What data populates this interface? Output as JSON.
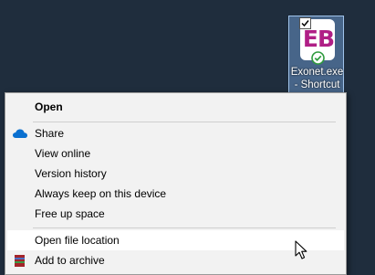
{
  "desktop": {
    "shortcut": {
      "logo_text": "EB",
      "label": "Exonet.exe - Shortcut",
      "logo_color": "#b01f86",
      "icon": "check-icon",
      "badge_icon": "sync-check-icon"
    },
    "background_color": "#1f2d3d"
  },
  "context_menu": {
    "items": [
      {
        "label": "Open",
        "bold": true
      },
      {
        "label": "Share",
        "icon": "onedrive-cloud-icon"
      },
      {
        "label": "View online"
      },
      {
        "label": "Version history"
      },
      {
        "label": "Always keep on this device"
      },
      {
        "label": "Free up space"
      },
      {
        "label": "Open file location",
        "highlighted": true
      },
      {
        "label": "Add to archive",
        "icon": "winrar-icon"
      }
    ],
    "cloud_icon_color": "#0a70d0"
  }
}
